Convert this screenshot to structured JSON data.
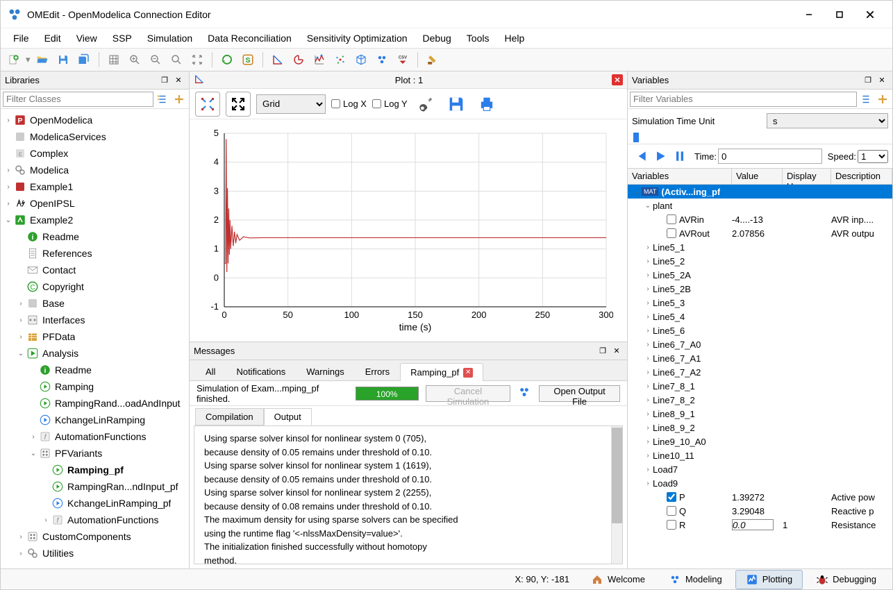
{
  "window": {
    "title": "OMEdit - OpenModelica Connection Editor"
  },
  "menubar": [
    "File",
    "Edit",
    "View",
    "SSP",
    "Simulation",
    "Data Reconciliation",
    "Sensitivity Optimization",
    "Debug",
    "Tools",
    "Help"
  ],
  "libraries": {
    "title": "Libraries",
    "filter_placeholder": "Filter Classes",
    "items": [
      {
        "lvl": 0,
        "exp": ">",
        "icon": "P",
        "label": "OpenModelica",
        "color": "#c03030"
      },
      {
        "lvl": 0,
        "exp": "",
        "icon": "box",
        "label": "ModelicaServices",
        "color": "#ccc"
      },
      {
        "lvl": 0,
        "exp": "",
        "icon": "c",
        "label": "Complex",
        "color": "#ccc"
      },
      {
        "lvl": 0,
        "exp": ">",
        "icon": "gears",
        "label": "Modelica",
        "color": "#888"
      },
      {
        "lvl": 0,
        "exp": ">",
        "icon": "box",
        "label": "Example1",
        "color": "#c03030"
      },
      {
        "lvl": 0,
        "exp": ">",
        "icon": "ipsl",
        "label": "OpenIPSL",
        "color": "#000"
      },
      {
        "lvl": 0,
        "exp": "v",
        "icon": "pkg",
        "label": "Example2",
        "color": "#2da02d"
      },
      {
        "lvl": 1,
        "exp": "",
        "icon": "info",
        "label": "Readme",
        "color": "#2da02d"
      },
      {
        "lvl": 1,
        "exp": "",
        "icon": "doc",
        "label": "References",
        "color": "#888"
      },
      {
        "lvl": 1,
        "exp": "",
        "icon": "mail",
        "label": "Contact",
        "color": "#888"
      },
      {
        "lvl": 1,
        "exp": "",
        "icon": "copy",
        "label": "Copyright",
        "color": "#2da02d"
      },
      {
        "lvl": 1,
        "exp": ">",
        "icon": "box",
        "label": "Base",
        "color": "#ccc"
      },
      {
        "lvl": 1,
        "exp": ">",
        "icon": "if",
        "label": "Interfaces",
        "color": "#888"
      },
      {
        "lvl": 1,
        "exp": ">",
        "icon": "db",
        "label": "PFData",
        "color": "#d9a23a"
      },
      {
        "lvl": 1,
        "exp": "v",
        "icon": "play2",
        "label": "Analysis",
        "color": "#2da02d"
      },
      {
        "lvl": 2,
        "exp": "",
        "icon": "info",
        "label": "Readme",
        "color": "#2da02d"
      },
      {
        "lvl": 2,
        "exp": "",
        "icon": "play",
        "label": "Ramping",
        "color": "#2da02d"
      },
      {
        "lvl": 2,
        "exp": "",
        "icon": "play",
        "label": "RampingRand...oadAndInput",
        "color": "#2da02d"
      },
      {
        "lvl": 2,
        "exp": "",
        "icon": "playb",
        "label": "KchangeLinRamping",
        "color": "#2b7de9"
      },
      {
        "lvl": 2,
        "exp": ">",
        "icon": "fn",
        "label": "AutomationFunctions",
        "color": "#ccc"
      },
      {
        "lvl": 2,
        "exp": "v",
        "icon": "dots",
        "label": "PFVariants",
        "color": "#888"
      },
      {
        "lvl": 3,
        "exp": "",
        "icon": "play",
        "label": "Ramping_pf",
        "color": "#2da02d",
        "selected": true
      },
      {
        "lvl": 3,
        "exp": "",
        "icon": "play",
        "label": "RampingRan...ndInput_pf",
        "color": "#2da02d"
      },
      {
        "lvl": 3,
        "exp": "",
        "icon": "playb",
        "label": "KchangeLinRamping_pf",
        "color": "#2b7de9"
      },
      {
        "lvl": 3,
        "exp": ">",
        "icon": "fn",
        "label": "AutomationFunctions",
        "color": "#ccc"
      },
      {
        "lvl": 1,
        "exp": ">",
        "icon": "dots",
        "label": "CustomComponents",
        "color": "#888"
      },
      {
        "lvl": 1,
        "exp": ">",
        "icon": "gears",
        "label": "Utilities",
        "color": "#888"
      }
    ]
  },
  "plot": {
    "title": "Plot : 1",
    "view_mode": "Grid",
    "logx": false,
    "logy": false,
    "xlabel": "time (s)"
  },
  "chart_data": {
    "type": "line",
    "title": "",
    "xlabel": "time (s)",
    "ylabel": "",
    "xlim": [
      0,
      300
    ],
    "ylim": [
      -1,
      5
    ],
    "xticks": [
      0,
      50,
      100,
      150,
      200,
      250,
      300
    ],
    "yticks": [
      -1,
      0,
      1,
      2,
      3,
      4,
      5
    ],
    "series": [
      {
        "name": "P",
        "color": "#c03030",
        "x": [
          0,
          1,
          1.5,
          2,
          2.5,
          3,
          3.5,
          4,
          4.5,
          5,
          6,
          7,
          8,
          9,
          10,
          12,
          15,
          20,
          30,
          50,
          100,
          150,
          200,
          250,
          300
        ],
        "y": [
          0.5,
          0.5,
          4.8,
          0.2,
          3.1,
          0.5,
          2.4,
          0.8,
          2.0,
          1.0,
          1.8,
          1.1,
          1.6,
          1.2,
          1.5,
          1.3,
          1.42,
          1.38,
          1.39,
          1.39,
          1.39,
          1.39,
          1.39,
          1.39,
          1.39
        ]
      }
    ]
  },
  "messages": {
    "title": "Messages",
    "tabs": [
      "All",
      "Notifications",
      "Warnings",
      "Errors",
      "Ramping_pf"
    ],
    "active_tab": 4,
    "status_text": "Simulation of Exam...mping_pf finished.",
    "progress": "100%",
    "cancel_label": "Cancel Simulation",
    "open_output_label": "Open Output File",
    "subtabs": [
      "Compilation",
      "Output"
    ],
    "active_subtab": 1,
    "output_lines": [
      "Using sparse solver kinsol for nonlinear system 0 (705),",
      "because density of 0.05 remains under threshold of 0.10.",
      "Using sparse solver kinsol for nonlinear system 1 (1619),",
      "because density of 0.05 remains under threshold of 0.10.",
      "Using sparse solver kinsol for nonlinear system 2 (2255),",
      "because density of 0.08 remains under threshold of 0.10.",
      "The maximum density for using sparse solvers can be specified",
      "using the runtime flag '<-nlssMaxDensity=value>'.",
      "The initialization finished successfully without homotopy",
      "method."
    ]
  },
  "variables": {
    "title": "Variables",
    "filter_placeholder": "Filter Variables",
    "sim_unit_label": "Simulation Time Unit",
    "sim_unit": "s",
    "time_label": "Time:",
    "time_value": "0",
    "speed_label": "Speed:",
    "speed_value": "1",
    "columns": [
      "Variables",
      "Value",
      "Display Un",
      "Description"
    ],
    "items": [
      {
        "lvl": 0,
        "exp": "v",
        "mat": true,
        "label": "(Activ...ing_pf",
        "selected": true
      },
      {
        "lvl": 1,
        "exp": "v",
        "label": "plant"
      },
      {
        "lvl": 2,
        "cb": false,
        "label": "AVRin",
        "val": "-4....-13",
        "desc": "AVR inp...."
      },
      {
        "lvl": 2,
        "cb": false,
        "label": "AVRout",
        "val": "2.07856",
        "desc": "AVR outpu"
      },
      {
        "lvl": 1,
        "exp": ">",
        "label": "Line5_1"
      },
      {
        "lvl": 1,
        "exp": ">",
        "label": "Line5_2"
      },
      {
        "lvl": 1,
        "exp": ">",
        "label": "Line5_2A"
      },
      {
        "lvl": 1,
        "exp": ">",
        "label": "Line5_2B"
      },
      {
        "lvl": 1,
        "exp": ">",
        "label": "Line5_3"
      },
      {
        "lvl": 1,
        "exp": ">",
        "label": "Line5_4"
      },
      {
        "lvl": 1,
        "exp": ">",
        "label": "Line5_6"
      },
      {
        "lvl": 1,
        "exp": ">",
        "label": "Line6_7_A0"
      },
      {
        "lvl": 1,
        "exp": ">",
        "label": "Line6_7_A1"
      },
      {
        "lvl": 1,
        "exp": ">",
        "label": "Line6_7_A2"
      },
      {
        "lvl": 1,
        "exp": ">",
        "label": "Line7_8_1"
      },
      {
        "lvl": 1,
        "exp": ">",
        "label": "Line7_8_2"
      },
      {
        "lvl": 1,
        "exp": ">",
        "label": "Line8_9_1"
      },
      {
        "lvl": 1,
        "exp": ">",
        "label": "Line8_9_2"
      },
      {
        "lvl": 1,
        "exp": ">",
        "label": "Line9_10_A0"
      },
      {
        "lvl": 1,
        "exp": ">",
        "label": "Line10_11"
      },
      {
        "lvl": 1,
        "exp": ">",
        "label": "Load7"
      },
      {
        "lvl": 1,
        "exp": ">",
        "label": "Load9"
      },
      {
        "lvl": 2,
        "cb": true,
        "label": "P",
        "val": "1.39272",
        "desc": "Active pow"
      },
      {
        "lvl": 2,
        "cb": false,
        "label": "Q",
        "val": "3.29048",
        "desc": "Reactive p"
      },
      {
        "lvl": 2,
        "cb": false,
        "label": "R",
        "val": "0.0",
        "valbox": true,
        "unit": "1",
        "desc": "Resistance"
      }
    ]
  },
  "statusbar": {
    "coords": "X: 90, Y: -181",
    "modes": [
      "Welcome",
      "Modeling",
      "Plotting",
      "Debugging"
    ],
    "active_mode": 2
  }
}
